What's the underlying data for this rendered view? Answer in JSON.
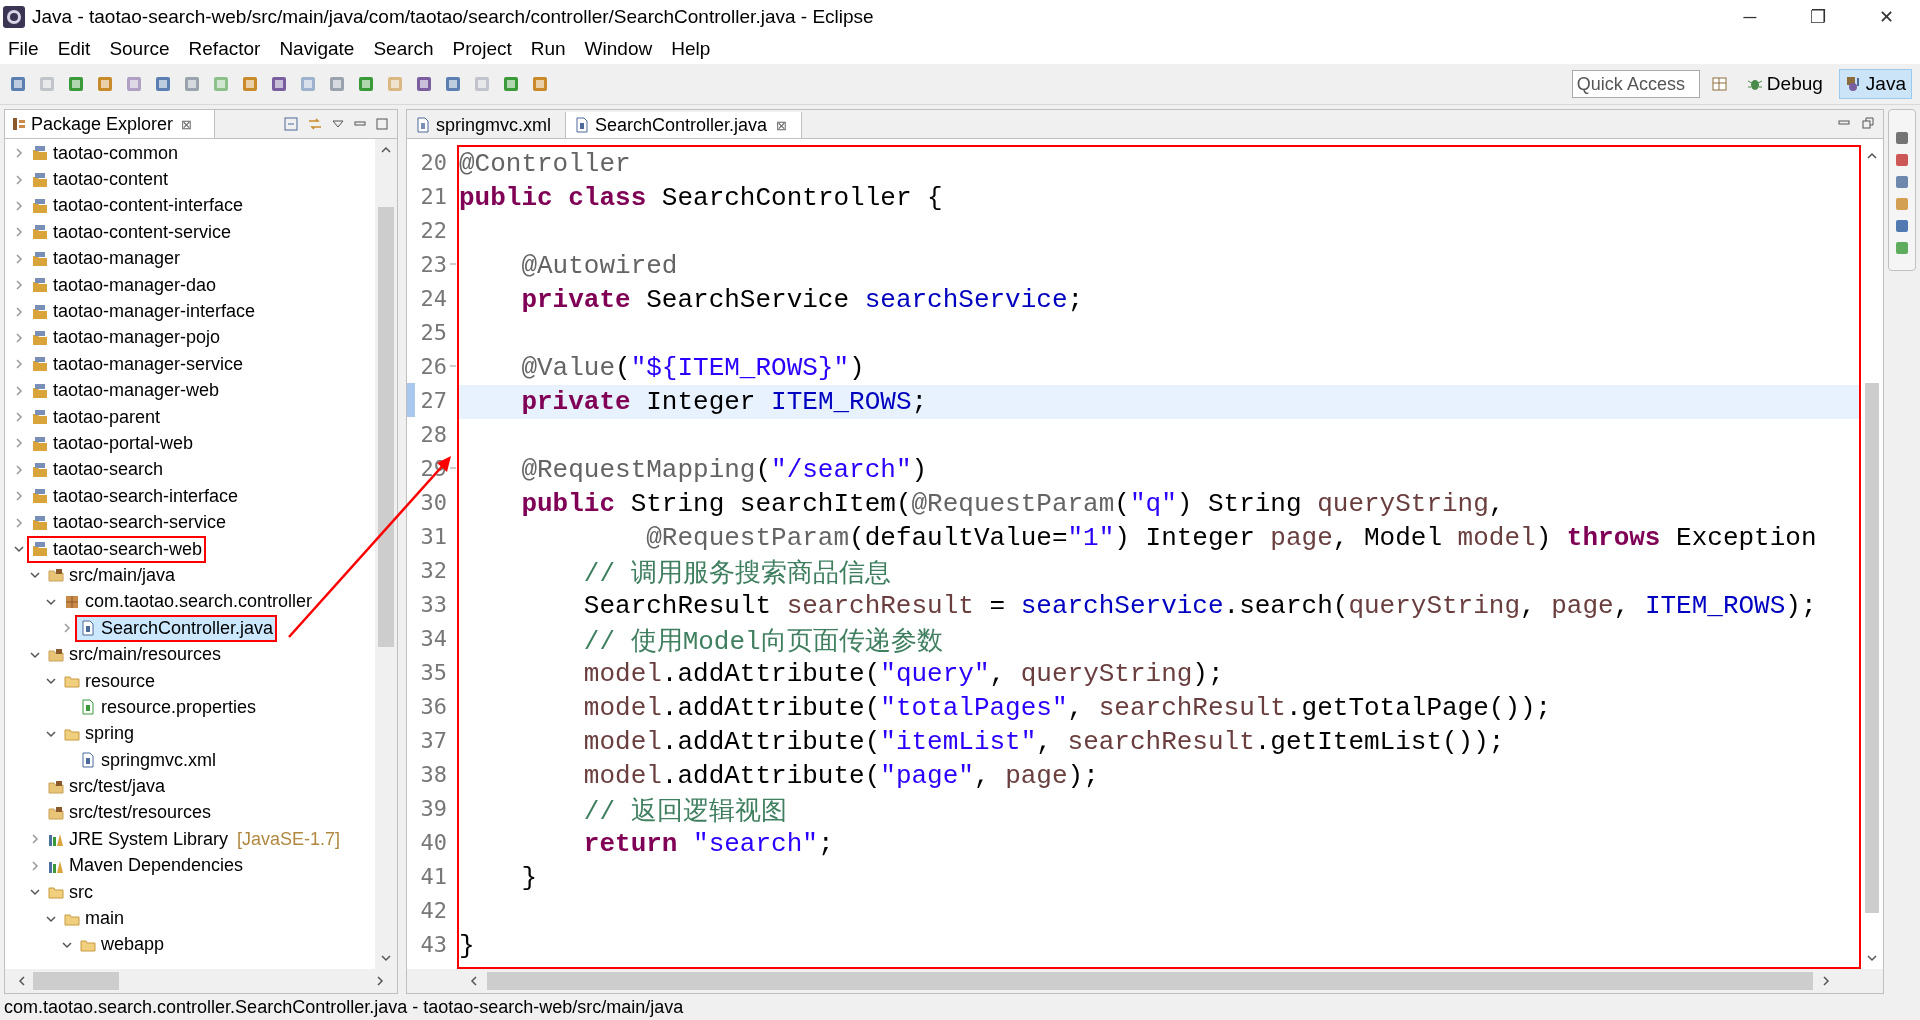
{
  "window": {
    "title": "Java - taotao-search-web/src/main/java/com/taotao/search/controller/SearchController.java - Eclipse",
    "controls": [
      "─",
      "❐",
      "✕"
    ]
  },
  "menu": [
    "File",
    "Edit",
    "Source",
    "Refactor",
    "Navigate",
    "Search",
    "Project",
    "Run",
    "Window",
    "Help"
  ],
  "quick_access": {
    "placeholder": "Quick Access"
  },
  "perspectives": [
    {
      "label": "Debug",
      "kind": "debug",
      "selected": false
    },
    {
      "label": "Java",
      "kind": "java",
      "selected": true
    }
  ],
  "explorer": {
    "title": "Package Explorer",
    "close": "⊠",
    "tree": [
      {
        "label": "taotao-common",
        "kind": "project",
        "expanded": false,
        "selected": false,
        "boxed": false
      },
      {
        "label": "taotao-content",
        "kind": "project",
        "expanded": false,
        "selected": false,
        "boxed": false
      },
      {
        "label": "taotao-content-interface",
        "kind": "project",
        "expanded": false,
        "selected": false,
        "boxed": false
      },
      {
        "label": "taotao-content-service",
        "kind": "project",
        "expanded": false,
        "selected": false,
        "boxed": false
      },
      {
        "label": "taotao-manager",
        "kind": "project",
        "expanded": false,
        "selected": false,
        "boxed": false
      },
      {
        "label": "taotao-manager-dao",
        "kind": "project",
        "expanded": false,
        "selected": false,
        "boxed": false
      },
      {
        "label": "taotao-manager-interface",
        "kind": "project",
        "expanded": false,
        "selected": false,
        "boxed": false
      },
      {
        "label": "taotao-manager-pojo",
        "kind": "project",
        "expanded": false,
        "selected": false,
        "boxed": false
      },
      {
        "label": "taotao-manager-service",
        "kind": "project",
        "expanded": false,
        "selected": false,
        "boxed": false
      },
      {
        "label": "taotao-manager-web",
        "kind": "project",
        "expanded": false,
        "selected": false,
        "boxed": false
      },
      {
        "label": "taotao-parent",
        "kind": "project",
        "expanded": false,
        "selected": false,
        "boxed": false
      },
      {
        "label": "taotao-portal-web",
        "kind": "project",
        "expanded": false,
        "selected": false,
        "boxed": false
      },
      {
        "label": "taotao-search",
        "kind": "project",
        "expanded": false,
        "selected": false,
        "boxed": false
      },
      {
        "label": "taotao-search-interface",
        "kind": "project",
        "expanded": false,
        "selected": false,
        "boxed": false
      },
      {
        "label": "taotao-search-service",
        "kind": "project",
        "expanded": false,
        "selected": false,
        "boxed": false
      },
      {
        "label": "taotao-search-web",
        "kind": "project",
        "expanded": true,
        "selected": false,
        "boxed": true,
        "children": [
          {
            "label": "src/main/java",
            "kind": "source-folder",
            "expanded": true,
            "selected": false,
            "boxed": false,
            "children": [
              {
                "label": "com.taotao.search.controller",
                "kind": "package",
                "expanded": true,
                "selected": false,
                "boxed": false,
                "children": [
                  {
                    "label": "SearchController.java",
                    "kind": "java-file",
                    "expanded": false,
                    "selected": true,
                    "boxed": true
                  }
                ]
              }
            ]
          },
          {
            "label": "src/main/resources",
            "kind": "source-folder",
            "expanded": true,
            "selected": false,
            "boxed": false,
            "children": [
              {
                "label": "resource",
                "kind": "folder",
                "expanded": true,
                "selected": false,
                "boxed": false,
                "children": [
                  {
                    "label": "resource.properties",
                    "kind": "properties-file",
                    "selected": false,
                    "boxed": false
                  }
                ]
              },
              {
                "label": "spring",
                "kind": "folder",
                "expanded": true,
                "selected": false,
                "boxed": false,
                "children": [
                  {
                    "label": "springmvc.xml",
                    "kind": "xml-file",
                    "selected": false,
                    "boxed": false
                  }
                ]
              }
            ]
          },
          {
            "label": "src/test/java",
            "kind": "source-folder",
            "selected": false,
            "boxed": false
          },
          {
            "label": "src/test/resources",
            "kind": "source-folder",
            "selected": false,
            "boxed": false
          },
          {
            "label": "JRE System Library",
            "suffix": "[JavaSE-1.7]",
            "kind": "library",
            "expanded": false,
            "selected": false,
            "boxed": false
          },
          {
            "label": "Maven Dependencies",
            "kind": "library",
            "expanded": false,
            "selected": false,
            "boxed": false
          },
          {
            "label": "src",
            "kind": "folder",
            "expanded": true,
            "selected": false,
            "boxed": false,
            "children": [
              {
                "label": "main",
                "kind": "folder",
                "expanded": true,
                "selected": false,
                "boxed": false,
                "children": [
                  {
                    "label": "webapp",
                    "kind": "folder",
                    "expanded": true,
                    "selected": false,
                    "boxed": false
                  }
                ]
              }
            ]
          }
        ]
      }
    ]
  },
  "editor_tabs": [
    {
      "label": "springmvc.xml",
      "kind": "xml-file",
      "selected": false
    },
    {
      "label": "SearchController.java",
      "kind": "java-file",
      "selected": true,
      "close": "⊠"
    }
  ],
  "editor": {
    "boxed": true,
    "lines": [
      {
        "number": "20",
        "fold": false,
        "current": false,
        "tokens": [
          {
            "kind": "ann",
            "text": "@Controller"
          }
        ]
      },
      {
        "number": "21",
        "fold": false,
        "current": false,
        "tokens": [
          {
            "kind": "kw",
            "text": "public"
          },
          {
            "kind": "kw",
            "text": " class"
          },
          {
            "kind": "plain",
            "text": " SearchController {"
          }
        ]
      },
      {
        "number": "22",
        "fold": false,
        "current": false
      },
      {
        "number": "23",
        "fold": true,
        "current": false,
        "tokens": [
          {
            "kind": "ann",
            "text": "    @Autowired"
          }
        ]
      },
      {
        "number": "24",
        "fold": false,
        "current": false,
        "tokens": [
          {
            "kind": "kw",
            "text": "    private"
          },
          {
            "kind": "plain",
            "text": " SearchService "
          },
          {
            "kind": "field",
            "text": "searchService"
          },
          {
            "kind": "plain",
            "text": ";"
          }
        ]
      },
      {
        "number": "25",
        "fold": false,
        "current": false
      },
      {
        "number": "26",
        "fold": true,
        "current": false,
        "tokens": [
          {
            "kind": "ann",
            "text": "    @Value"
          },
          {
            "kind": "plain",
            "text": "("
          },
          {
            "kind": "str",
            "text": "\"${ITEM_ROWS}\""
          },
          {
            "kind": "plain",
            "text": ")"
          }
        ]
      },
      {
        "number": "27",
        "fold": false,
        "current": true,
        "tokens": [
          {
            "kind": "kw",
            "text": "    private"
          },
          {
            "kind": "plain",
            "text": " Integer "
          },
          {
            "kind": "field",
            "text": "ITEM_ROWS"
          },
          {
            "kind": "plain",
            "text": ";"
          }
        ]
      },
      {
        "number": "28",
        "fold": false,
        "current": false
      },
      {
        "number": "29",
        "fold": true,
        "current": false,
        "tokens": [
          {
            "kind": "ann",
            "text": "    @RequestMapping"
          },
          {
            "kind": "plain",
            "text": "("
          },
          {
            "kind": "str",
            "text": "\"/search\""
          },
          {
            "kind": "plain",
            "text": ")"
          }
        ]
      },
      {
        "number": "30",
        "fold": false,
        "current": false,
        "tokens": [
          {
            "kind": "kw",
            "text": "    public"
          },
          {
            "kind": "plain",
            "text": " String searchItem("
          },
          {
            "kind": "ann",
            "text": "@RequestParam"
          },
          {
            "kind": "plain",
            "text": "("
          },
          {
            "kind": "str",
            "text": "\"q\""
          },
          {
            "kind": "plain",
            "text": ") String "
          },
          {
            "kind": "var",
            "text": "queryString"
          },
          {
            "kind": "plain",
            "text": ","
          }
        ]
      },
      {
        "number": "31",
        "fold": false,
        "current": false,
        "tokens": [
          {
            "kind": "ann",
            "text": "            @RequestParam"
          },
          {
            "kind": "plain",
            "text": "(defaultValue="
          },
          {
            "kind": "str",
            "text": "\"1\""
          },
          {
            "kind": "plain",
            "text": ") Integer "
          },
          {
            "kind": "var",
            "text": "page"
          },
          {
            "kind": "plain",
            "text": ", Model "
          },
          {
            "kind": "var",
            "text": "model"
          },
          {
            "kind": "plain",
            "text": ") "
          },
          {
            "kind": "kw",
            "text": "throws"
          },
          {
            "kind": "plain",
            "text": " Exception"
          }
        ]
      },
      {
        "number": "32",
        "fold": false,
        "current": false,
        "tokens": [
          {
            "kind": "cmt",
            "text": "        // 调用服务搜索商品信息"
          }
        ]
      },
      {
        "number": "33",
        "fold": false,
        "current": false,
        "tokens": [
          {
            "kind": "plain",
            "text": "        SearchResult "
          },
          {
            "kind": "var",
            "text": "searchResult"
          },
          {
            "kind": "plain",
            "text": " = "
          },
          {
            "kind": "field",
            "text": "searchService"
          },
          {
            "kind": "plain",
            "text": ".search("
          },
          {
            "kind": "var",
            "text": "queryString"
          },
          {
            "kind": "plain",
            "text": ", "
          },
          {
            "kind": "var",
            "text": "page"
          },
          {
            "kind": "plain",
            "text": ", "
          },
          {
            "kind": "field",
            "text": "ITEM_ROWS"
          },
          {
            "kind": "plain",
            "text": ");"
          }
        ]
      },
      {
        "number": "34",
        "fold": false,
        "current": false,
        "tokens": [
          {
            "kind": "cmt",
            "text": "        // 使用Model向页面传递参数"
          }
        ]
      },
      {
        "number": "35",
        "fold": false,
        "current": false,
        "tokens": [
          {
            "kind": "var",
            "text": "        model"
          },
          {
            "kind": "plain",
            "text": ".addAttribute("
          },
          {
            "kind": "str",
            "text": "\"query\""
          },
          {
            "kind": "plain",
            "text": ", "
          },
          {
            "kind": "var",
            "text": "queryString"
          },
          {
            "kind": "plain",
            "text": ");"
          }
        ]
      },
      {
        "number": "36",
        "fold": false,
        "current": false,
        "tokens": [
          {
            "kind": "var",
            "text": "        model"
          },
          {
            "kind": "plain",
            "text": ".addAttribute("
          },
          {
            "kind": "str",
            "text": "\"totalPages\""
          },
          {
            "kind": "plain",
            "text": ", "
          },
          {
            "kind": "var",
            "text": "searchResult"
          },
          {
            "kind": "plain",
            "text": ".getTotalPage());"
          }
        ]
      },
      {
        "number": "37",
        "fold": false,
        "current": false,
        "tokens": [
          {
            "kind": "var",
            "text": "        model"
          },
          {
            "kind": "plain",
            "text": ".addAttribute("
          },
          {
            "kind": "str",
            "text": "\"itemList\""
          },
          {
            "kind": "plain",
            "text": ", "
          },
          {
            "kind": "var",
            "text": "searchResult"
          },
          {
            "kind": "plain",
            "text": ".getItemList());"
          }
        ]
      },
      {
        "number": "38",
        "fold": false,
        "current": false,
        "tokens": [
          {
            "kind": "var",
            "text": "        model"
          },
          {
            "kind": "plain",
            "text": ".addAttribute("
          },
          {
            "kind": "str",
            "text": "\"page\""
          },
          {
            "kind": "plain",
            "text": ", "
          },
          {
            "kind": "var",
            "text": "page"
          },
          {
            "kind": "plain",
            "text": ");"
          }
        ]
      },
      {
        "number": "39",
        "fold": false,
        "current": false,
        "tokens": [
          {
            "kind": "cmt",
            "text": "        // 返回逻辑视图"
          }
        ]
      },
      {
        "number": "40",
        "fold": false,
        "current": false,
        "tokens": [
          {
            "kind": "kw",
            "text": "        return"
          },
          {
            "kind": "str",
            "text": " \"search\""
          },
          {
            "kind": "plain",
            "text": ";"
          }
        ]
      },
      {
        "number": "41",
        "fold": false,
        "current": false,
        "tokens": [
          {
            "kind": "plain",
            "text": "    }"
          }
        ]
      },
      {
        "number": "42",
        "fold": false,
        "current": false
      },
      {
        "number": "43",
        "fold": false,
        "current": false,
        "tokens": [
          {
            "kind": "plain",
            "text": "}"
          }
        ]
      }
    ]
  },
  "status_bar": "com.taotao.search.controller.SearchController.java - taotao-search-web/src/main/java"
}
